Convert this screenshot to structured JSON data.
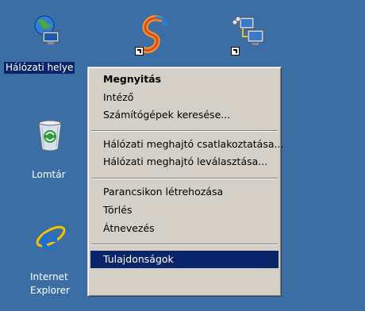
{
  "desktop": {
    "icons": [
      {
        "name": "network-places",
        "label": "Hálózati helye",
        "selected": true
      },
      {
        "name": "app-shortcut-1",
        "label": ""
      },
      {
        "name": "app-shortcut-2",
        "label": ""
      },
      {
        "name": "recycle-bin",
        "label": "Lomtár"
      },
      {
        "name": "internet-explorer",
        "label_line1": "Internet",
        "label_line2": "Explorer"
      }
    ]
  },
  "context_menu": {
    "items": [
      {
        "label": "Megnyitás",
        "bold": true
      },
      {
        "label": "Intéző"
      },
      {
        "label": "Számítógépek keresése..."
      },
      {
        "label": "Hálózati meghajtó csatlakoztatása..."
      },
      {
        "label": "Hálózati meghajtó leválasztása..."
      },
      {
        "label": "Parancsikon létrehozása"
      },
      {
        "label": "Törlés"
      },
      {
        "label": "Átnevezés"
      },
      {
        "label": "Tulajdonságok",
        "highlighted": true
      }
    ]
  },
  "colors": {
    "desktop_bg": "#3a6ea5",
    "menu_bg": "#d4d0c8",
    "highlight": "#0a246a"
  }
}
